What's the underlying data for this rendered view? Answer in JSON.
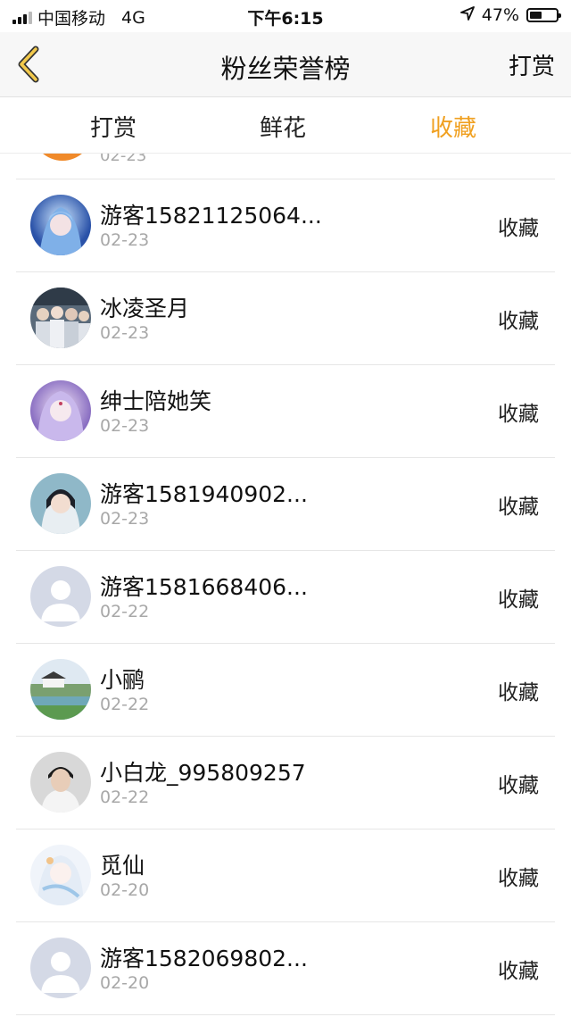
{
  "status_bar": {
    "carrier": "中国移动",
    "network": "4G",
    "time": "下午6:15",
    "battery": "47%",
    "battery_level": 0.47
  },
  "header": {
    "title": "粉丝荣誉榜",
    "action": "打赏"
  },
  "tabs": [
    {
      "label": "打赏",
      "active": false
    },
    {
      "label": "鲜花",
      "active": false
    },
    {
      "label": "收藏",
      "active": true
    }
  ],
  "accent_color": "#f0a020",
  "partial_row": {
    "date": "02-23"
  },
  "rows": [
    {
      "name": "游客15821125064...",
      "date": "02-23",
      "action": "收藏",
      "avatar": "anime-blue-hair"
    },
    {
      "name": "冰凌圣月",
      "date": "02-23",
      "action": "收藏",
      "avatar": "group-photo"
    },
    {
      "name": "绅士陪她笑",
      "date": "02-23",
      "action": "收藏",
      "avatar": "anime-purple"
    },
    {
      "name": "游客1581940902...",
      "date": "02-23",
      "action": "收藏",
      "avatar": "costume-portrait"
    },
    {
      "name": "游客1581668406...",
      "date": "02-22",
      "action": "收藏",
      "avatar": "default"
    },
    {
      "name": "小鹂",
      "date": "02-22",
      "action": "收藏",
      "avatar": "landscape"
    },
    {
      "name": "小白龙_995809257",
      "date": "02-22",
      "action": "收藏",
      "avatar": "man-portrait"
    },
    {
      "name": "觅仙",
      "date": "02-20",
      "action": "收藏",
      "avatar": "anime-white"
    },
    {
      "name": "游客1582069802...",
      "date": "02-20",
      "action": "收藏",
      "avatar": "default"
    }
  ]
}
